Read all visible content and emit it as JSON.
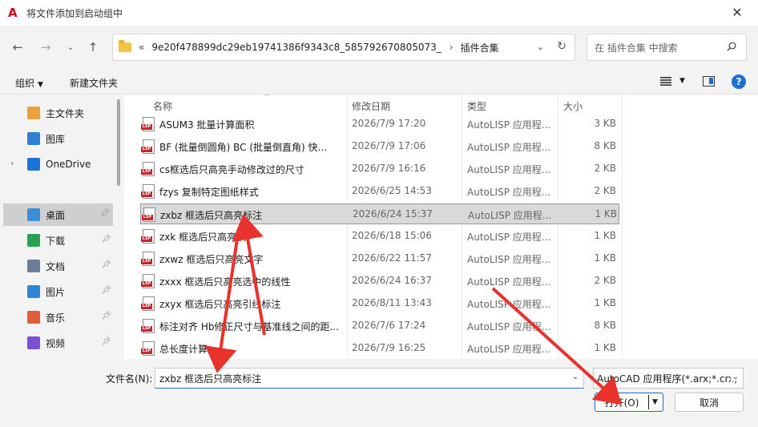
{
  "window": {
    "title": "将文件添加到启动组中",
    "close_glyph": "✕"
  },
  "address": {
    "overflow": "«",
    "path": [
      "9e20f478899dc29eb19741386f9343c8_585792670805073_",
      "插件合集"
    ],
    "separator": "›"
  },
  "search": {
    "placeholder": "在 插件合集 中搜索"
  },
  "toolbar": {
    "organize": "组织",
    "new_folder": "新建文件夹"
  },
  "sidebar": {
    "items": [
      {
        "label": "主文件夹",
        "icon": "home-icon",
        "color": "#e8a33d"
      },
      {
        "label": "图库",
        "icon": "gallery-icon",
        "color": "#2f7fd4"
      },
      {
        "label": "OneDrive",
        "icon": "cloud-icon",
        "color": "#1a73d8"
      },
      {
        "label": "桌面",
        "icon": "desktop-icon",
        "color": "#3b8fd6"
      },
      {
        "label": "下载",
        "icon": "download-icon",
        "color": "#2aa053"
      },
      {
        "label": "文档",
        "icon": "document-icon",
        "color": "#6a7f94"
      },
      {
        "label": "图片",
        "icon": "pictures-icon",
        "color": "#2f86d9"
      },
      {
        "label": "音乐",
        "icon": "music-icon",
        "color": "#e05d3a"
      },
      {
        "label": "视频",
        "icon": "video-icon",
        "color": "#7a4fd0"
      }
    ]
  },
  "columns": {
    "name": "名称",
    "date": "修改日期",
    "type": "类型",
    "size": "大小"
  },
  "files": [
    {
      "name": "ASUM3 批量计算面积",
      "date": "2026/7/9 17:20",
      "type": "AutoLISP 应用程...",
      "size": "3 KB"
    },
    {
      "name": "BF (批量倒圆角)     BC (批量倒直角) 快...",
      "date": "2026/7/9 17:06",
      "type": "AutoLISP 应用程...",
      "size": "8 KB"
    },
    {
      "name": "cs框选后只高亮手动修改过的尺寸",
      "date": "2026/7/9 16:16",
      "type": "AutoLISP 应用程...",
      "size": "2 KB"
    },
    {
      "name": "fzys 复制特定图纸样式",
      "date": "2026/6/25 14:53",
      "type": "AutoLISP 应用程...",
      "size": "2 KB"
    },
    {
      "name": "zxbz 框选后只高亮标注",
      "date": "2026/6/24 15:37",
      "type": "AutoLISP 应用程...",
      "size": "1 KB"
    },
    {
      "name": "zxk 框选后只高亮块",
      "date": "2026/6/18 15:06",
      "type": "AutoLISP 应用程...",
      "size": "1 KB"
    },
    {
      "name": "zxwz 框选后只高亮文字",
      "date": "2026/6/22 11:57",
      "type": "AutoLISP 应用程...",
      "size": "1 KB"
    },
    {
      "name": "zxxx 框选后只高亮选中的线性",
      "date": "2026/6/24 16:37",
      "type": "AutoLISP 应用程...",
      "size": "2 KB"
    },
    {
      "name": "zxyx 框选后只高亮引线标注",
      "date": "2026/8/11 13:43",
      "type": "AutoLISP 应用程...",
      "size": "1 KB"
    },
    {
      "name": "标注对齐   Hb修正尺寸与基准线之间的距...",
      "date": "2026/7/6 17:24",
      "type": "AutoLISP 应用程...",
      "size": "8 KB"
    },
    {
      "name": "总长度计算",
      "date": "2026/7/9 16:25",
      "type": "AutoLISP 应用程...",
      "size": "1 KB"
    }
  ],
  "selected_file_index": 4,
  "bottom": {
    "filename_label": "文件名(N):",
    "filename_value": "zxbz 框选后只高亮标注",
    "filetype_value": "AutoCAD 应用程序(*.arx;*.crx;",
    "open_label": "打开(O)",
    "cancel_label": "取消"
  },
  "colors": {
    "accent": "#1a6fc4",
    "annotation_arrow": "#e8322b",
    "lsp_badge": "#c4282d"
  }
}
